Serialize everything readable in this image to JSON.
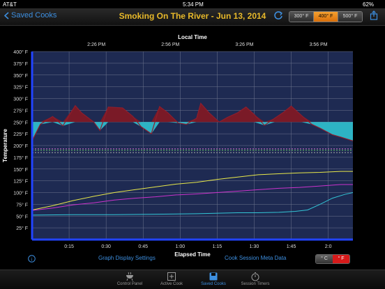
{
  "status": {
    "carrier": "AT&T",
    "time": "5:34 PM",
    "battery": "62%"
  },
  "nav": {
    "back_label": "Saved Cooks",
    "title": "Smoking On The River - Jun 13, 2014"
  },
  "temp_segments": [
    "300° F",
    "400° F",
    "500° F"
  ],
  "temp_selected": "400° F",
  "chart_data": {
    "type": "line",
    "title": "Local Time",
    "xlabel": "Elapsed Time",
    "ylabel": "Temperature",
    "top_ticks": [
      "2:26 PM",
      "2:56 PM",
      "3:26 PM",
      "3:56 PM"
    ],
    "x_ticks": [
      "0:15",
      "0:30",
      "0:45",
      "1:00",
      "1:15",
      "1:30",
      "1:45",
      "2:0"
    ],
    "y_ticks": [
      "25° F",
      "50° F",
      "75° F",
      "100° F",
      "125° F",
      "150° F",
      "175° F",
      "200° F",
      "225° F",
      "250° F",
      "275° F",
      "300° F",
      "325° F",
      "350° F",
      "375° F",
      "400° F"
    ],
    "ylim": [
      0,
      400
    ],
    "xlim": [
      0,
      120
    ],
    "setpoint": 250,
    "series": [
      {
        "color": "#8e1d2c",
        "points": [
          [
            0,
            210
          ],
          [
            4,
            245
          ],
          [
            10,
            262
          ],
          [
            15,
            242
          ],
          [
            21,
            285
          ],
          [
            24,
            270
          ],
          [
            30,
            250
          ],
          [
            33,
            232
          ],
          [
            37,
            282
          ],
          [
            44,
            280
          ],
          [
            49,
            262
          ],
          [
            53,
            240
          ],
          [
            58,
            225
          ],
          [
            62,
            283
          ],
          [
            66,
            270
          ],
          [
            71,
            248
          ],
          [
            75,
            245
          ],
          [
            80,
            258
          ],
          [
            82,
            290
          ],
          [
            86,
            270
          ],
          [
            91,
            250
          ],
          [
            95,
            260
          ],
          [
            100,
            270
          ],
          [
            104,
            282
          ],
          [
            108,
            266
          ],
          [
            113,
            243
          ],
          [
            118,
            258
          ],
          [
            122,
            270
          ],
          [
            126,
            284
          ],
          [
            131,
            264
          ],
          [
            136,
            245
          ],
          [
            140,
            237
          ],
          [
            146,
            223
          ],
          [
            150,
            218
          ],
          [
            156,
            210
          ]
        ]
      },
      {
        "color": "#e8e84a",
        "points": [
          [
            0,
            63
          ],
          [
            10,
            72
          ],
          [
            20,
            83
          ],
          [
            30,
            92
          ],
          [
            40,
            100
          ],
          [
            50,
            106
          ],
          [
            60,
            112
          ],
          [
            70,
            118
          ],
          [
            80,
            122
          ],
          [
            90,
            128
          ],
          [
            100,
            133
          ],
          [
            110,
            138
          ],
          [
            120,
            140
          ],
          [
            130,
            142
          ],
          [
            140,
            143
          ],
          [
            150,
            145
          ],
          [
            156,
            145
          ]
        ]
      },
      {
        "color": "#cc33cc",
        "points": [
          [
            0,
            62
          ],
          [
            10,
            67
          ],
          [
            20,
            74
          ],
          [
            30,
            78
          ],
          [
            40,
            84
          ],
          [
            50,
            88
          ],
          [
            60,
            91
          ],
          [
            70,
            95
          ],
          [
            80,
            97
          ],
          [
            90,
            100
          ],
          [
            100,
            103
          ],
          [
            110,
            106
          ],
          [
            120,
            109
          ],
          [
            130,
            111
          ],
          [
            140,
            114
          ],
          [
            150,
            117
          ],
          [
            156,
            117
          ]
        ]
      },
      {
        "color": "#33c6d6",
        "points": [
          [
            0,
            52
          ],
          [
            20,
            53
          ],
          [
            40,
            53
          ],
          [
            60,
            54
          ],
          [
            80,
            55
          ],
          [
            100,
            57
          ],
          [
            110,
            57
          ],
          [
            120,
            58
          ],
          [
            128,
            60
          ],
          [
            134,
            63
          ],
          [
            140,
            75
          ],
          [
            146,
            88
          ],
          [
            152,
            96
          ],
          [
            156,
            100
          ]
        ]
      },
      {
        "color": "#aaaaaa",
        "dashed": true,
        "points": [
          [
            0,
            185
          ],
          [
            156,
            185
          ]
        ]
      },
      {
        "color": "#66cc66",
        "dashed": true,
        "points": [
          [
            0,
            190
          ],
          [
            156,
            190
          ]
        ]
      },
      {
        "color": "#cc66cc",
        "dashed": true,
        "points": [
          [
            0,
            193
          ],
          [
            156,
            193
          ]
        ]
      }
    ]
  },
  "links": {
    "graph_settings": "Graph Display Settings",
    "meta": "Cook Session Meta Data"
  },
  "units": {
    "c": "° C",
    "f": "° F"
  },
  "tabs": [
    {
      "label": "Control Panel",
      "icon": "grill-icon"
    },
    {
      "label": "Active Cook",
      "icon": "plus-icon"
    },
    {
      "label": "Saved Cooks",
      "icon": "floppy-icon"
    },
    {
      "label": "Session Timers",
      "icon": "stopwatch-icon"
    }
  ]
}
